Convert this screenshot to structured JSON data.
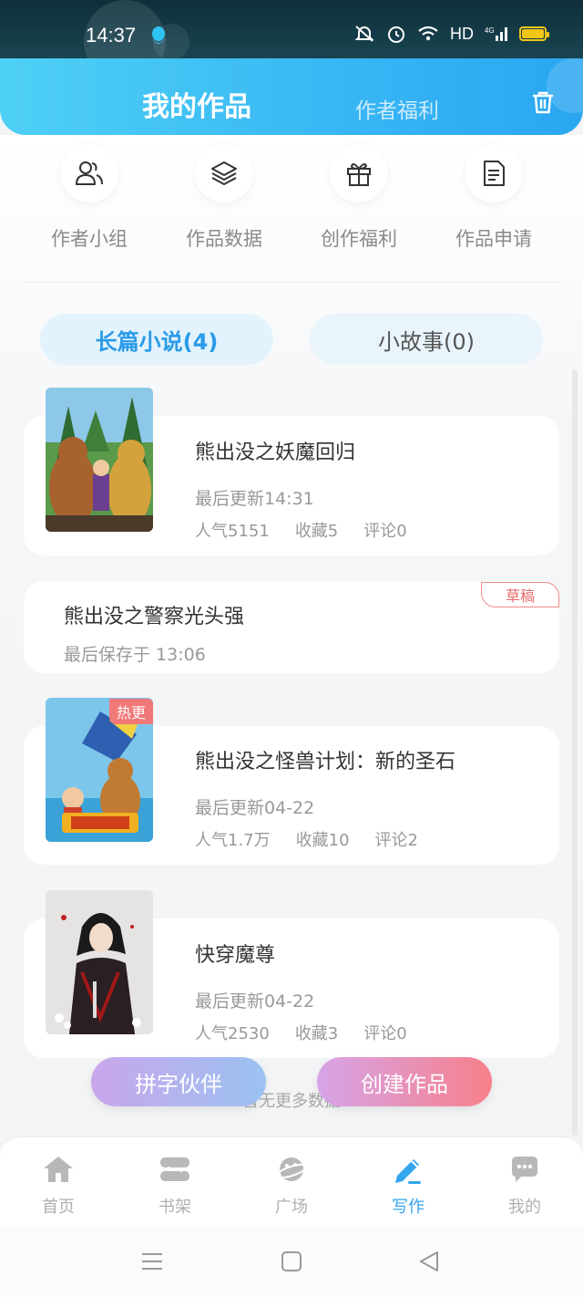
{
  "status_bar": {
    "time": "14:37",
    "network": "HD",
    "signal": "4G"
  },
  "header": {
    "title": "我的作品",
    "secondary_tab": "作者福利",
    "trash_icon": "trash-icon"
  },
  "quick_menu": [
    {
      "label": "作者小组",
      "icon": "users-icon"
    },
    {
      "label": "作品数据",
      "icon": "layers-icon"
    },
    {
      "label": "创作福利",
      "icon": "gift-icon"
    },
    {
      "label": "作品申请",
      "icon": "document-icon"
    }
  ],
  "tabs": {
    "novel": "长篇小说(4)",
    "story": "小故事(0)"
  },
  "books": [
    {
      "title": "熊出没之妖魔回归",
      "updated": "最后更新14:31",
      "popularity": "人气5151",
      "favorites": "收藏5",
      "comments": "评论0"
    },
    {
      "title": "熊出没之怪兽计划：新的圣石",
      "updated": "最后更新04-22",
      "popularity": "人气1.7万",
      "favorites": "收藏10",
      "comments": "评论2",
      "badge": "热更"
    },
    {
      "title": "快穿魔尊",
      "updated": "最后更新04-22",
      "popularity": "人气2530",
      "favorites": "收藏3",
      "comments": "评论0"
    }
  ],
  "draft": {
    "title": "熊出没之警察光头强",
    "saved": "最后保存于 13:06",
    "badge": "草稿"
  },
  "footer_text": "暂无更多数据",
  "actions": {
    "partner": "拼字伙伴",
    "create": "创建作品"
  },
  "bottom_nav": [
    {
      "label": "首页",
      "icon": "home-icon"
    },
    {
      "label": "书架",
      "icon": "bookshelf-icon"
    },
    {
      "label": "广场",
      "icon": "planet-icon"
    },
    {
      "label": "写作",
      "icon": "pen-icon",
      "active": true
    },
    {
      "label": "我的",
      "icon": "chat-bubble-icon"
    }
  ],
  "colors": {
    "accent": "#34a6ef",
    "header_start": "#4fd0f5",
    "header_end": "#2aa6f1",
    "draft": "#e86a6a",
    "hot": "#f07878"
  }
}
